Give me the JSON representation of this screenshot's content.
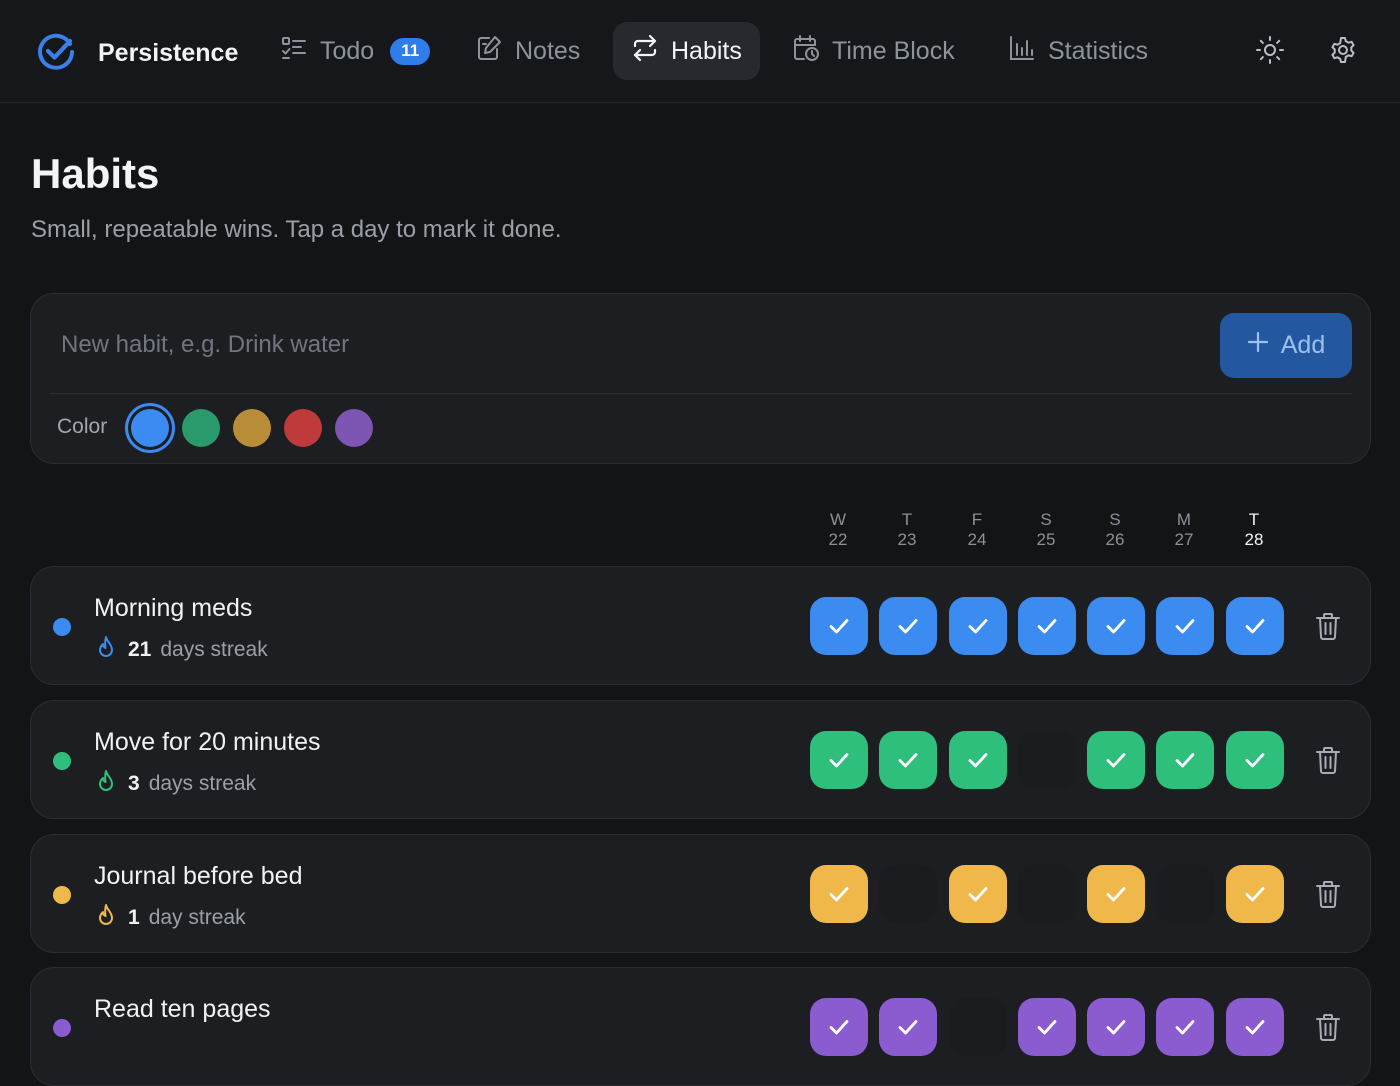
{
  "app": {
    "name": "Persistence"
  },
  "nav": [
    {
      "label": "Todo",
      "icon": "list-checks-icon",
      "badge": "11",
      "active": false
    },
    {
      "label": "Notes",
      "icon": "edit-note-icon",
      "badge": null,
      "active": false
    },
    {
      "label": "Habits",
      "icon": "repeat-arrows-icon",
      "badge": null,
      "active": true
    },
    {
      "label": "Time Block",
      "icon": "calendar-clock-icon",
      "badge": null,
      "active": false
    },
    {
      "label": "Statistics",
      "icon": "bar-chart-icon",
      "badge": null,
      "active": false
    }
  ],
  "header_icons": [
    "sun-icon",
    "gear-icon"
  ],
  "page": {
    "title": "Habits",
    "subtitle": "Small, repeatable wins. Tap a day to mark it done."
  },
  "new_habit": {
    "placeholder": "New habit, e.g. Drink water",
    "value": "",
    "add_label": "Add",
    "color_label": "Color",
    "colors": [
      "#3b8bf0",
      "#2a9a6c",
      "#b98c38",
      "#bf3a3a",
      "#7d55b3"
    ],
    "selected_color": 0
  },
  "days": [
    {
      "letter": "W",
      "date": "22"
    },
    {
      "letter": "T",
      "date": "23"
    },
    {
      "letter": "F",
      "date": "24"
    },
    {
      "letter": "S",
      "date": "25"
    },
    {
      "letter": "S",
      "date": "26"
    },
    {
      "letter": "M",
      "date": "27"
    },
    {
      "letter": "T",
      "date": "28",
      "today": true
    }
  ],
  "habits": [
    {
      "name": "Morning meds",
      "streak_count": "21",
      "streak_text": "days streak",
      "color": "#3b8bf0",
      "done": [
        true,
        true,
        true,
        true,
        true,
        true,
        true
      ]
    },
    {
      "name": "Move for 20 minutes",
      "streak_count": "3",
      "streak_text": "days streak",
      "color": "#2fbf7c",
      "done": [
        true,
        true,
        true,
        false,
        true,
        true,
        true
      ]
    },
    {
      "name": "Journal before bed",
      "streak_count": "1",
      "streak_text": "day streak",
      "color": "#f0b84a",
      "done": [
        true,
        false,
        true,
        false,
        true,
        false,
        true
      ]
    },
    {
      "name": "Read ten pages",
      "streak_count": "",
      "streak_text": "",
      "color": "#8b5bd0",
      "done": [
        true,
        true,
        false,
        true,
        true,
        true,
        true
      ]
    }
  ]
}
